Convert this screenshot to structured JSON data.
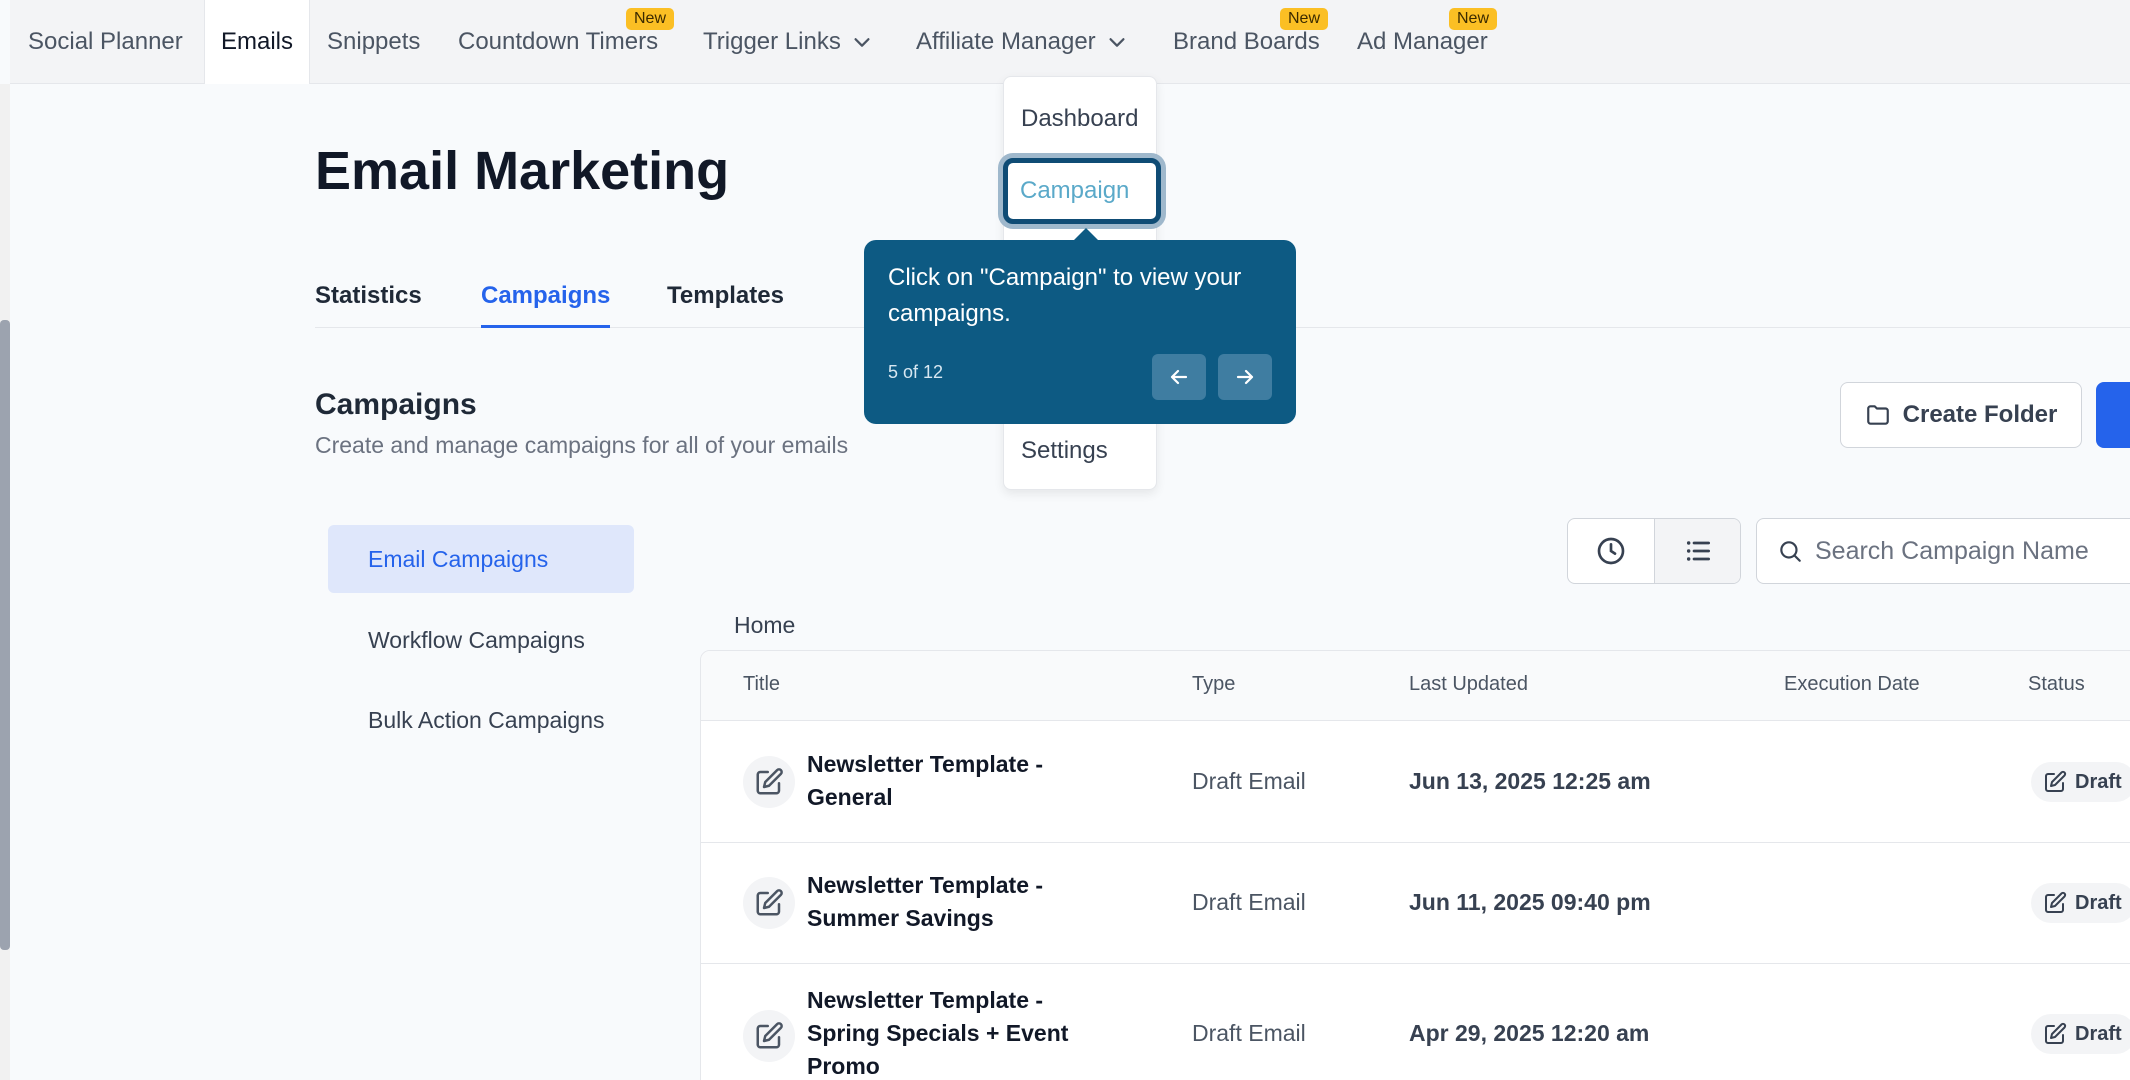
{
  "nav": {
    "items": [
      {
        "label": "Social Planner"
      },
      {
        "label": "Emails"
      },
      {
        "label": "Snippets"
      },
      {
        "label": "Countdown Timers",
        "badge": "New"
      },
      {
        "label": "Trigger Links"
      },
      {
        "label": "Affiliate Manager"
      },
      {
        "label": "Brand Boards",
        "badge": "New"
      },
      {
        "label": "Ad Manager",
        "badge": "New"
      }
    ]
  },
  "page": {
    "title": "Email Marketing",
    "tabs": [
      {
        "label": "Statistics"
      },
      {
        "label": "Campaigns"
      },
      {
        "label": "Templates"
      }
    ],
    "section_title": "Campaigns",
    "section_subtitle": "Create and manage campaigns for all of your emails",
    "create_folder_label": "Create Folder"
  },
  "sidebar": {
    "items": [
      {
        "label": "Email Campaigns"
      },
      {
        "label": "Workflow Campaigns"
      },
      {
        "label": "Bulk Action Campaigns"
      }
    ]
  },
  "search": {
    "placeholder": "Search Campaign Name"
  },
  "breadcrumb": "Home",
  "table": {
    "columns": [
      "Title",
      "Type",
      "Last Updated",
      "Execution Date",
      "Status"
    ],
    "rows": [
      {
        "title_line1": "Newsletter Template -",
        "title_line2": "General",
        "title_line3": "",
        "type": "Draft Email",
        "updated": "Jun 13, 2025 12:25 am",
        "status": "Draft"
      },
      {
        "title_line1": "Newsletter Template -",
        "title_line2": "Summer Savings",
        "title_line3": "",
        "type": "Draft Email",
        "updated": "Jun 11, 2025 09:40 pm",
        "status": "Draft"
      },
      {
        "title_line1": "Newsletter Template -",
        "title_line2": "Spring Specials + Event",
        "title_line3": "Promo",
        "type": "Draft Email",
        "updated": "Apr 29, 2025 12:20 am",
        "status": "Draft"
      }
    ]
  },
  "dropdown": {
    "items": [
      {
        "label": "Dashboard"
      },
      {
        "label": "Campaign"
      },
      {
        "label": "Settings"
      }
    ]
  },
  "tooltip": {
    "message": "Click on \"Campaign\" to view your campaigns.",
    "step": "5 of 12"
  },
  "colors": {
    "accent": "#2563eb",
    "tooltip_bg": "#0d5a83",
    "badge": "#fbbf24"
  }
}
